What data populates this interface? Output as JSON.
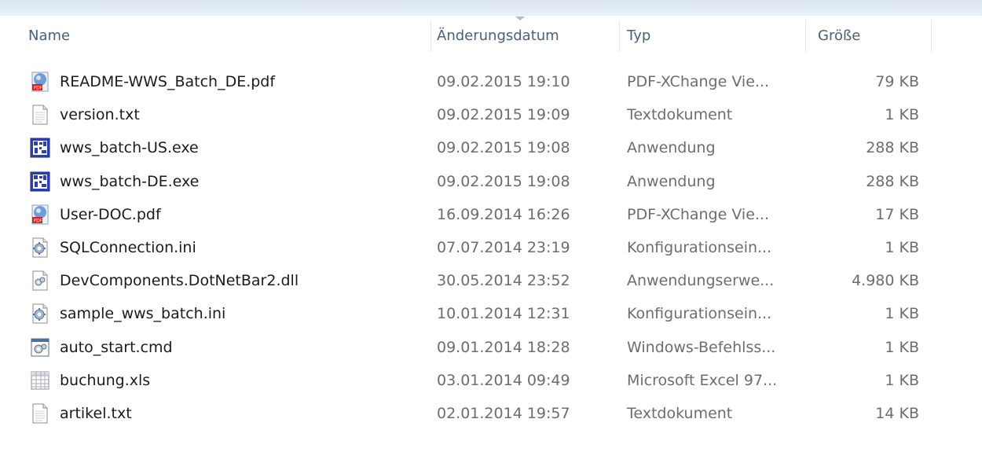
{
  "header": {
    "columns": {
      "name": "Name",
      "date": "Änderungsdatum",
      "type": "Typ",
      "size": "Größe"
    }
  },
  "files": [
    {
      "icon": "pdf-icon",
      "name": "README-WWS_Batch_DE.pdf",
      "date": "09.02.2015 19:10",
      "type": "PDF-XChange Vie...",
      "size": "79 KB"
    },
    {
      "icon": "text-file-icon",
      "name": "version.txt",
      "date": "09.02.2015 19:09",
      "type": "Textdokument",
      "size": "1 KB"
    },
    {
      "icon": "application-icon",
      "name": "wws_batch-US.exe",
      "date": "09.02.2015 19:08",
      "type": "Anwendung",
      "size": "288 KB"
    },
    {
      "icon": "application-icon",
      "name": "wws_batch-DE.exe",
      "date": "09.02.2015 19:08",
      "type": "Anwendung",
      "size": "288 KB"
    },
    {
      "icon": "pdf-icon",
      "name": "User-DOC.pdf",
      "date": "16.09.2014 16:26",
      "type": "PDF-XChange Vie...",
      "size": "17 KB"
    },
    {
      "icon": "config-file-icon",
      "name": "SQLConnection.ini",
      "date": "07.07.2014 23:19",
      "type": "Konfigurationsein...",
      "size": "1 KB"
    },
    {
      "icon": "dll-icon",
      "name": "DevComponents.DotNetBar2.dll",
      "date": "30.05.2014 23:52",
      "type": "Anwendungserwe...",
      "size": "4.980 KB"
    },
    {
      "icon": "config-file-icon",
      "name": "sample_wws_batch.ini",
      "date": "10.01.2014 12:31",
      "type": "Konfigurationsein...",
      "size": "1 KB"
    },
    {
      "icon": "cmd-script-icon",
      "name": "auto_start.cmd",
      "date": "09.01.2014 18:28",
      "type": "Windows-Befehlss...",
      "size": "1 KB"
    },
    {
      "icon": "spreadsheet-icon",
      "name": "buchung.xls",
      "date": "03.01.2014 09:49",
      "type": "Microsoft Excel 97...",
      "size": "1 KB"
    },
    {
      "icon": "text-file-icon",
      "name": "artikel.txt",
      "date": "02.01.2014 19:57",
      "type": "Textdokument",
      "size": "14 KB"
    }
  ]
}
